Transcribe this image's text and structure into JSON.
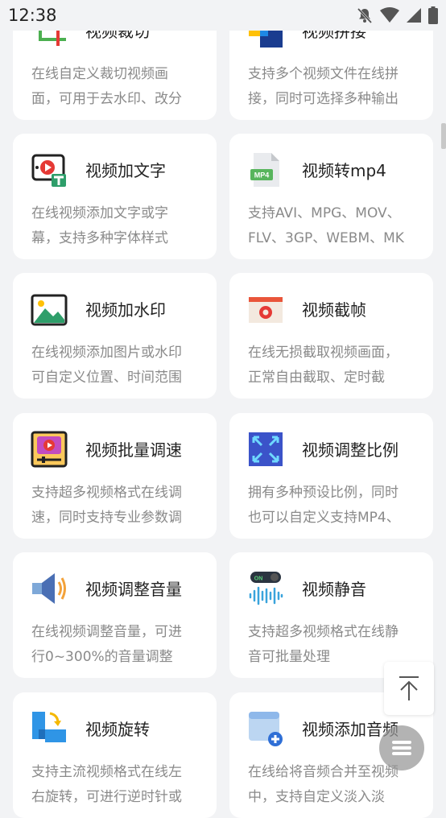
{
  "status_bar": {
    "time": "12:38"
  },
  "cards": [
    {
      "title": "视频裁切",
      "desc": [
        "在线自定义裁切视频画",
        "面，可用于去水印、改分"
      ],
      "icon": "crop-icon"
    },
    {
      "title": "视频拼接",
      "desc": [
        "支持多个视频文件在线拼",
        "接，同时可选择多种输出"
      ],
      "icon": "merge-icon"
    },
    {
      "title": "视频加文字",
      "desc": [
        "在线视频添加文字或字",
        "幕，支持多种字体样式"
      ],
      "icon": "video-text-icon"
    },
    {
      "title": "视频转mp4",
      "desc": [
        "支持AVI、MPG、MOV、",
        "FLV、3GP、WEBM、MK"
      ],
      "icon": "mp4-file-icon",
      "icon_label": "MP4"
    },
    {
      "title": "视频加水印",
      "desc": [
        "在线视频添加图片或水印",
        "可自定义位置、时间范围"
      ],
      "icon": "image-watermark-icon"
    },
    {
      "title": "视频截帧",
      "desc": [
        "在线无损截取视频画面，",
        "正常自由截取、定时截"
      ],
      "icon": "camera-frame-icon"
    },
    {
      "title": "视频批量调速",
      "desc": [
        "支持超多视频格式在线调",
        "速，同时支持专业参数调"
      ],
      "icon": "speed-adjust-icon"
    },
    {
      "title": "视频调整比例",
      "desc": [
        "拥有多种预设比例，同时",
        "也可以自定义支持MP4、"
      ],
      "icon": "aspect-ratio-icon"
    },
    {
      "title": "视频调整音量",
      "desc": [
        "在线视频调整音量，可进",
        "行0~300%的音量调整"
      ],
      "icon": "speaker-icon"
    },
    {
      "title": "视频静音",
      "desc": [
        "支持超多视频格式在线静",
        "音可批量处理"
      ],
      "icon": "mute-toggle-icon",
      "icon_label": "ON"
    },
    {
      "title": "视频旋转",
      "desc": [
        "支持主流视频格式在线左",
        "右旋转，可进行逆时针或"
      ],
      "icon": "rotate-icon"
    },
    {
      "title": "视频添加音频",
      "desc": [
        "在线给将音频合并至视频",
        "中，支持自定义淡入淡"
      ],
      "icon": "add-audio-icon"
    }
  ],
  "colors": {
    "background": "#f2f3f5",
    "card": "#ffffff",
    "title": "#222222",
    "desc": "#8a8a8a"
  }
}
